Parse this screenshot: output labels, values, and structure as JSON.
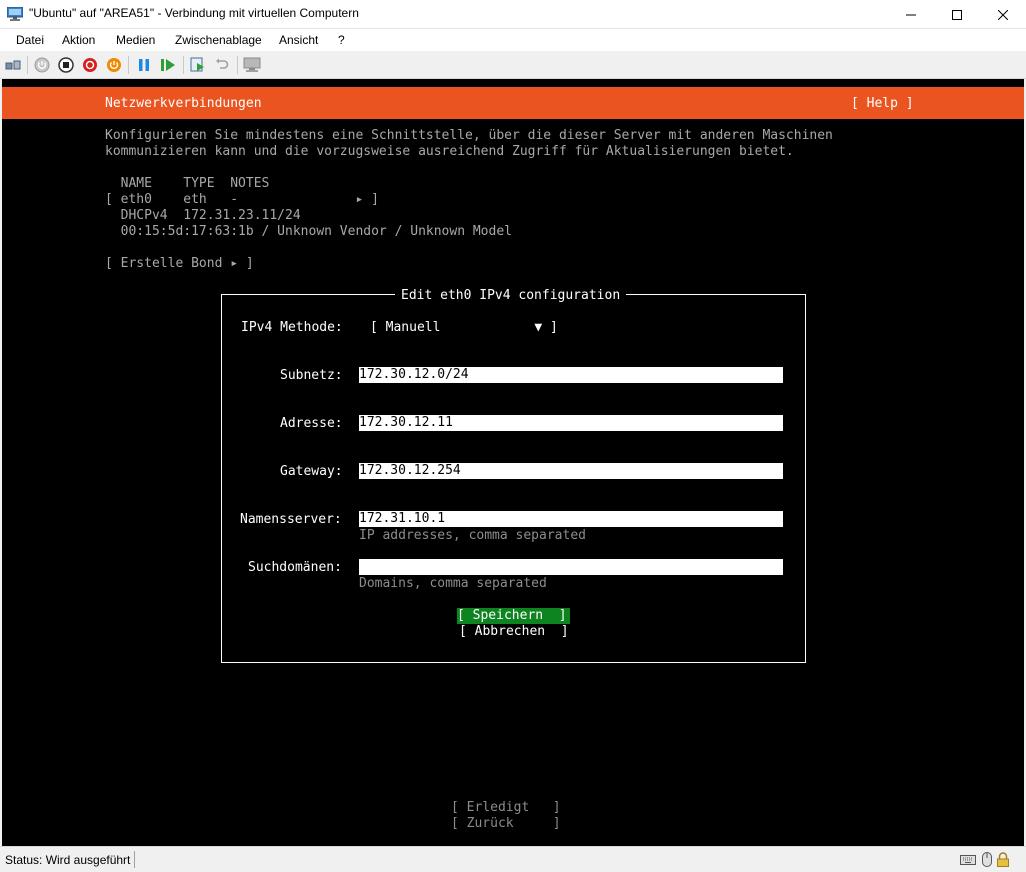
{
  "window": {
    "title": "\"Ubuntu\" auf \"AREA51\" - Verbindung mit virtuellen Computern",
    "minimize": "—",
    "maximize": "☐",
    "close": "✕"
  },
  "menu": {
    "items": [
      "Datei",
      "Aktion",
      "Medien",
      "Zwischenablage",
      "Ansicht",
      "?"
    ]
  },
  "toolbar": {
    "icons": [
      "ctrl-alt-del-icon",
      "power-start-icon",
      "stop-icon",
      "shutdown-icon",
      "power-icon",
      "pause-icon",
      "resume-icon",
      "checkpoint-icon",
      "revert-icon",
      "enhanced-session-icon"
    ]
  },
  "header": {
    "title": "Netzwerkverbindungen",
    "help": "[ Help ]",
    "color": "#e95420"
  },
  "intro": {
    "line1": "Konfigurieren Sie mindestens eine Schnittstelle, über die dieser Server mit anderen Maschinen",
    "line2": "kommunizieren kann und die vorzugsweise ausreichend Zugriff für Aktualisierungen bietet."
  },
  "interfaces": {
    "header": "  NAME    TYPE  NOTES",
    "row": "[ eth0    eth   -               ▸ ]",
    "dhcp": "  DHCPv4  172.31.23.11/24",
    "mac": "  00:15:5d:17:63:1b / Unknown Vendor / Unknown Model",
    "bond": "[ Erstelle Bond ▸ ]"
  },
  "dialog": {
    "title": "Edit eth0 IPv4 configuration",
    "method_label": "IPv4 Methode:",
    "method_value": "[ Manuell            ▼ ]",
    "subnet_label": "Subnetz:",
    "subnet_value": "172.30.12.0/24",
    "address_label": "Adresse:",
    "address_value": "172.30.12.11",
    "gateway_label": "Gateway:",
    "gateway_value": "172.30.12.254",
    "nameserver_label": "Namensserver:",
    "nameserver_value": "172.31.10.1",
    "nameserver_hint": "IP addresses, comma separated",
    "search_label": "Suchdomänen:",
    "search_value": "",
    "search_hint": "Domains, comma separated",
    "save": "[ Speichern  ]",
    "cancel": "[ Abbrechen  ]",
    "save_color": "#0e8420"
  },
  "footer": {
    "done": "[ Erledigt   ]",
    "back": "[ Zurück     ]"
  },
  "status": {
    "text": "Status: Wird ausgeführt",
    "icons": [
      "keyboard-icon",
      "mouse-icon",
      "lock-icon"
    ]
  }
}
